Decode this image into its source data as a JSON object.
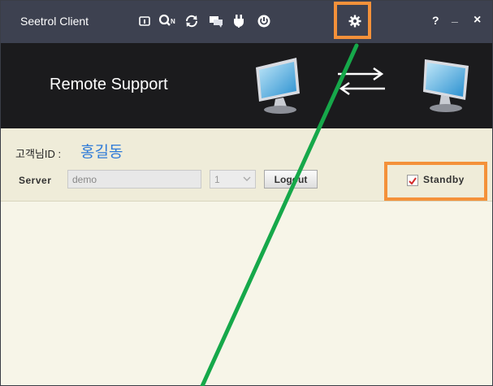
{
  "window": {
    "title": "Seetrol Client",
    "toolbar_icons": [
      "info-icon",
      "search-n-icon",
      "refresh-icon",
      "chat-icon",
      "plug-icon",
      "power-icon"
    ],
    "settings_icon": "gear-icon",
    "controls": {
      "help": "?",
      "minimize": "_",
      "close": "×"
    }
  },
  "banner": {
    "title": "Remote Support",
    "icons": [
      "monitor-icon",
      "transfer-arrows-icon",
      "monitor-icon"
    ]
  },
  "customer": {
    "label": "고객님ID :",
    "value": "홍길동"
  },
  "server": {
    "label": "Server",
    "value": "demo",
    "session_number": "1",
    "logout_label": "Logout"
  },
  "standby": {
    "label": "Standby",
    "checked": true
  },
  "colors": {
    "titlebar": "#3d4150",
    "banner": "#1b1b1d",
    "panel": "#efecd9",
    "highlight": "#f4913a",
    "pointer_line": "#16a84a",
    "customer_id": "#2f7bd8"
  }
}
